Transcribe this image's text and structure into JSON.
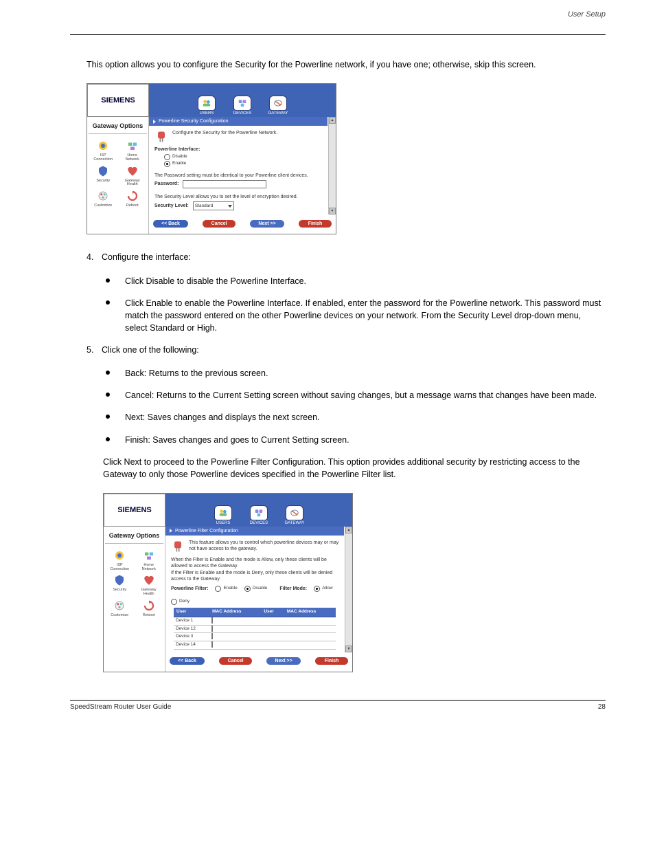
{
  "header": {
    "right": "User Setup"
  },
  "intro": "This option allows you to configure the Security for the Powerline network, if you have one; otherwise, skip this screen.",
  "shot1": {
    "logo": "SIEMENS",
    "tabs": [
      {
        "name": "users",
        "label": "USERS"
      },
      {
        "name": "devices",
        "label": "DEVICES"
      },
      {
        "name": "gateway",
        "label": "GATEWAY"
      }
    ],
    "sidebar_title": "Gateway Options",
    "sidebar": [
      {
        "name": "isp-connection",
        "label": "ISP\nConnection"
      },
      {
        "name": "home-network",
        "label": "Home\nNetwork"
      },
      {
        "name": "security",
        "label": "Security"
      },
      {
        "name": "gateway-health",
        "label": "Gateway\nHealth"
      },
      {
        "name": "customize",
        "label": "Customize"
      },
      {
        "name": "reboot",
        "label": "Reboot"
      }
    ],
    "section_title": "Powerline Security Configuration",
    "intro_line": "Configure the Security for the Powerline Network.",
    "iface_heading": "Powerline Interface:",
    "iface_options": {
      "disable": "Disable",
      "enable": "Enable"
    },
    "pw_line": "The Password setting must be identical to your Powerline client devices.",
    "pw_label": "Password:",
    "sec_line": "The Security Level allows you to set the level of encryption desired.",
    "sec_label": "Security Level:",
    "sec_value": "Standard",
    "nav": {
      "back": "<< Back",
      "cancel": "Cancel",
      "next": "Next >>",
      "finish": "Finish"
    }
  },
  "step4": {
    "num": "4.",
    "text": "Configure the interface:",
    "b_disable": "Click Disable to disable the Powerline Interface.",
    "b_enable": "Click Enable to enable the Powerline Interface. If enabled, enter the password for the Powerline network. This password must match the password entered on the other Powerline devices on your network. From the Security Level drop-down menu, select Standard or High."
  },
  "step5": {
    "num": "5.",
    "lead": "Click one of the following:",
    "b1": "Back: Returns to the previous screen.",
    "b2": "Cancel: Returns to the Current Setting screen without saving changes, but a message warns that changes have been made.",
    "b3": "Next: Saves changes and displays the next screen.",
    "b4": "Finish: Saves changes and goes to Current Setting screen.",
    "after": "Click Next to proceed to the Powerline Filter Configuration. This option provides additional security by restricting access to the Gateway to only those Powerline devices specified in the Powerline Filter list."
  },
  "shot2": {
    "logo": "SIEMENS",
    "section_title": "Powerline Filter Configuration",
    "intro_line": "This feature allows you to control which powerline devices may or may not have access to the gateway.",
    "para1": "When the Filter is Enable and the mode is Allow, only these clients will be allowed to access the Gateway.",
    "para2": "If the Filter is Enable and the mode is Deny, only these clients will be denied access to the Gateway.",
    "pf_label": "Powerline Filter:",
    "pf_enable": "Enable",
    "pf_disable": "Disable",
    "fm_label": "Filter Mode:",
    "fm_allow": "Allow",
    "fm_deny": "Deny",
    "table": {
      "h_user": "User",
      "h_mac": "MAC Address",
      "rows": [
        "Device 1",
        "Device 12",
        "Device 3",
        "Device 14"
      ]
    }
  },
  "footer": {
    "left": "SpeedStream Router User Guide",
    "right": "28"
  }
}
